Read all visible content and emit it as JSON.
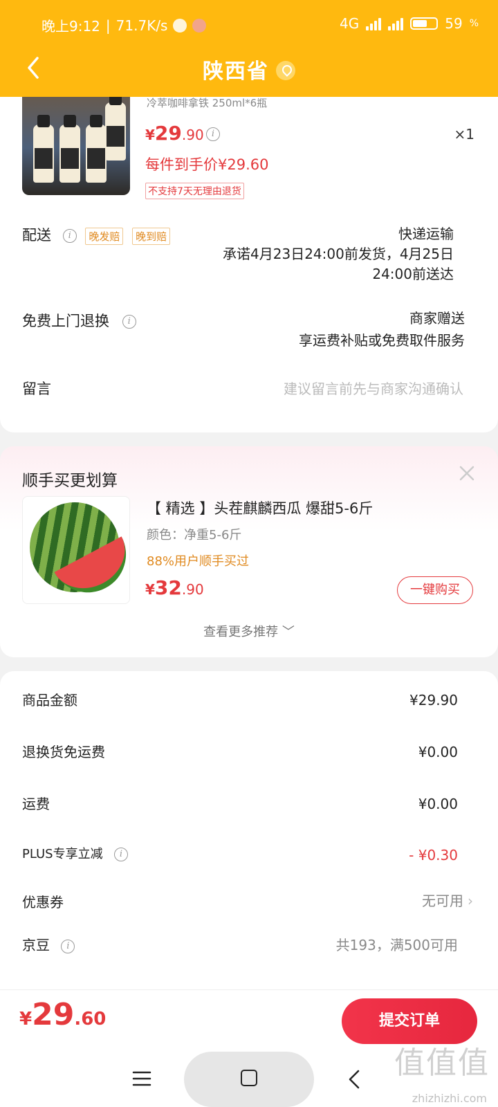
{
  "status": {
    "time": "晚上9:12",
    "speed": "71.7K/s",
    "network": "4G",
    "battery": "59"
  },
  "nav": {
    "title": "陕西省"
  },
  "product": {
    "subtitle": "冷萃咖啡拿铁 250ml*6瓶",
    "price_currency": "¥",
    "price_int": "29",
    "price_dec": ".90",
    "qty": "×1",
    "per_price": "每件到手价¥29.60",
    "no_return": "不支持7天无理由退货"
  },
  "delivery": {
    "label": "配送",
    "tags": [
      "晚发赔",
      "晚到赔"
    ],
    "line1": "快递运输",
    "line2": "承诺4月23日24:00前发货，4月25日",
    "line3": "24:00前送达"
  },
  "exchange": {
    "label": "免费上门退换",
    "line1": "商家赠送",
    "line2": "享运费补贴或免费取件服务"
  },
  "message": {
    "label": "留言",
    "placeholder": "建议留言前先与商家沟通确认"
  },
  "recommend": {
    "title": "顺手买更划算",
    "item_title": "【 精选 】头茬麒麟西瓜 爆甜5-6斤",
    "spec": "颜色：净重5-6斤",
    "percent": "88%用户顺手买过",
    "price_currency": "¥",
    "price_int": "32",
    "price_dec": ".90",
    "buy_label": "一键购买",
    "more_label": "查看更多推荐 ﹀"
  },
  "fees": [
    {
      "label": "商品金额",
      "value": "¥29.90"
    },
    {
      "label": "退换货免运费",
      "value": "¥0.00"
    },
    {
      "label": "运费",
      "value": "¥0.00"
    },
    {
      "label": "PLUS专享立减",
      "value": "- ¥0.30"
    },
    {
      "label": "优惠券",
      "value": "无可用"
    },
    {
      "label": "京豆",
      "value": "共193，满500可用"
    }
  ],
  "total": {
    "currency": "¥",
    "int": "29",
    "dec": ".60"
  },
  "submit_label": "提交订单",
  "watermark": {
    "main": "值值值",
    "sub": "zhizhizhi.com"
  },
  "colors": {
    "brand": "#FFB90F",
    "price_red": "#e4393c"
  }
}
